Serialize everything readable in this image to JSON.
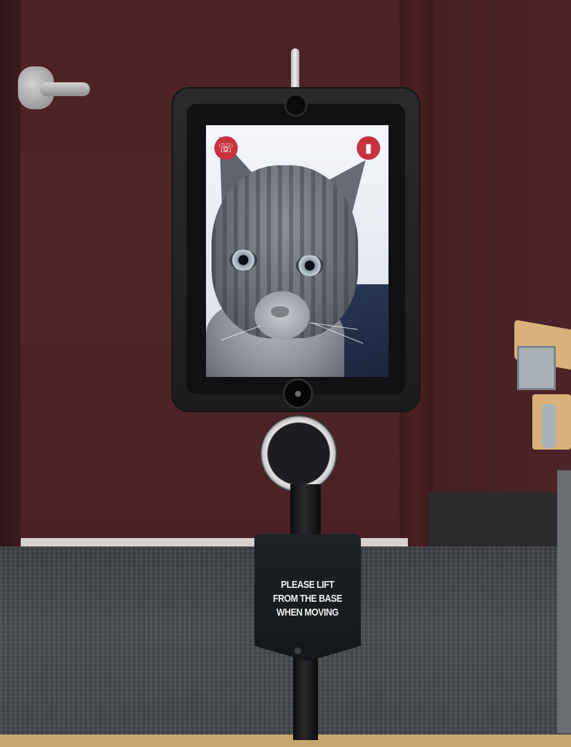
{
  "sign": {
    "lines": [
      "PLEASE LIFT",
      "FROM THE BASE",
      "WHEN MOVING"
    ]
  },
  "screen": {
    "hangup_icon": "phone-hangup-icon",
    "exit_icon": "exit-icon",
    "accent_color": "#c8323f"
  },
  "colors": {
    "door": "#4b2226",
    "carpet": "#44484c",
    "robot_body": "#1c1c1e"
  }
}
